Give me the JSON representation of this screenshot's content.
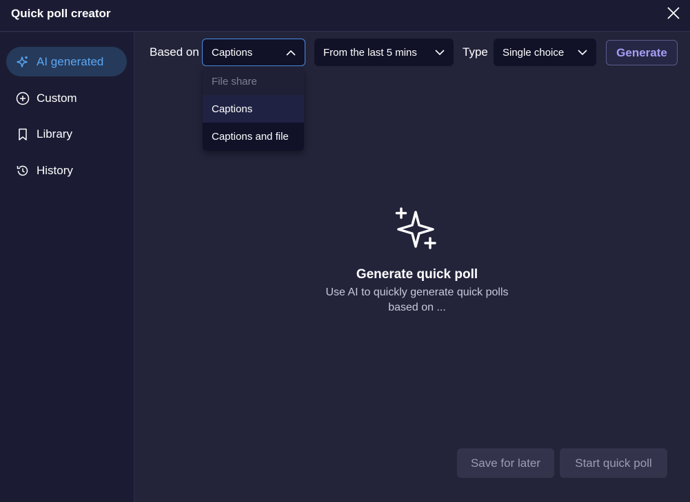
{
  "window": {
    "title": "Quick poll creator",
    "close_icon": "close-icon"
  },
  "sidebar": {
    "items": [
      {
        "label": "AI generated",
        "icon": "sparkle-icon",
        "active": true
      },
      {
        "label": "Custom",
        "icon": "plus-circle-icon",
        "active": false
      },
      {
        "label": "Library",
        "icon": "bookmark-icon",
        "active": false
      },
      {
        "label": "History",
        "icon": "history-icon",
        "active": false
      }
    ]
  },
  "toolbar": {
    "based_on_label": "Based on",
    "based_on_value": "Captions",
    "time_range_value": "From the last 5 mins",
    "type_label": "Type",
    "type_value": "Single choice",
    "generate_label": "Generate"
  },
  "based_on_dropdown": {
    "options": [
      {
        "label": "File share",
        "state": "disabled"
      },
      {
        "label": "Captions",
        "state": "selected"
      },
      {
        "label": "Captions and file",
        "state": "normal"
      }
    ]
  },
  "empty_state": {
    "icon": "sparkles-icon",
    "title": "Generate quick poll",
    "description": "Use AI to quickly generate quick polls based on ..."
  },
  "footer": {
    "save_label": "Save for later",
    "start_label": "Start quick poll"
  },
  "colors": {
    "accent_blue": "#5aa8f5",
    "generate_text": "#a59ef5",
    "background": "#23243a",
    "sidebar_bg": "#1b1c33"
  }
}
